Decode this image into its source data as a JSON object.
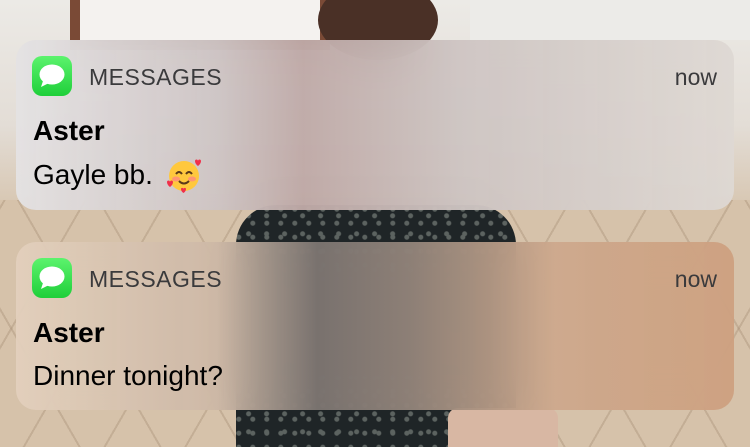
{
  "notifications": [
    {
      "app_name": "MESSAGES",
      "time": "now",
      "sender": "Aster",
      "message": "Gayle bb.",
      "emoji_icon": "smiling-face-with-hearts-icon"
    },
    {
      "app_name": "MESSAGES",
      "time": "now",
      "sender": "Aster",
      "message": "Dinner tonight?"
    }
  ],
  "colors": {
    "messages_icon_green": "#1fcf3a",
    "app_name_text": "#3a3a3c",
    "sender_text": "#000000"
  }
}
